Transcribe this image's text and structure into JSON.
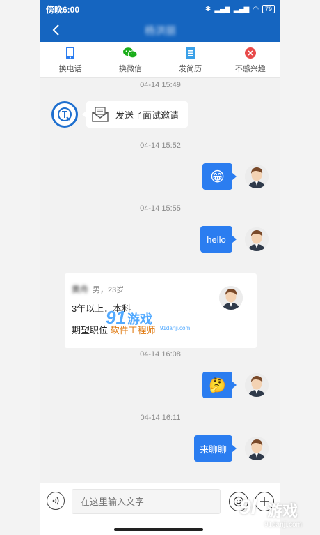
{
  "status_bar": {
    "time": "傍晚6:00",
    "battery": "79"
  },
  "header": {
    "title": "杨洪丽"
  },
  "actions": [
    {
      "label": "换电话",
      "icon": "phone-icon",
      "color": "#2b7df0"
    },
    {
      "label": "换微信",
      "icon": "wechat-icon",
      "color": "#1aad19"
    },
    {
      "label": "发简历",
      "icon": "resume-icon",
      "color": "#3aa0e8"
    },
    {
      "label": "不感兴趣",
      "icon": "close-icon",
      "color": "#e84a4a"
    }
  ],
  "messages": {
    "ts1": "04-14 15:49",
    "invite_text": "发送了面试邀请",
    "ts2": "04-14 15:52",
    "emoji1": "😁",
    "ts3": "04-14 15:55",
    "hello": "hello",
    "card": {
      "name": "黄舟",
      "meta": "男，23岁",
      "edu": "3年以上．本科",
      "expect_label": "期望职位",
      "expect_job": "软件工程师"
    },
    "ts4": "04-14 16:08",
    "emoji2": "🤔",
    "ts5": "04-14 16:11",
    "chat": "来聊聊"
  },
  "input": {
    "placeholder": "在这里输入文字"
  },
  "watermark": {
    "small_num": "91",
    "small_text": "游戏",
    "small_domain": "91danji.com",
    "big_num": "9l",
    "big_text": "游戏",
    "big_domain": "91danji.com"
  },
  "colors": {
    "primary": "#1565c0",
    "bubble": "#2b7df0",
    "job": "#e07b13"
  }
}
